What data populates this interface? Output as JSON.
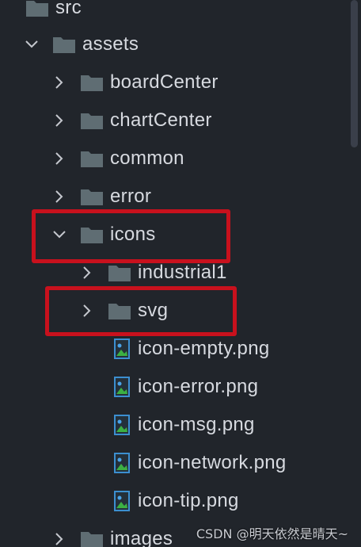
{
  "tree": {
    "rows": [
      {
        "label": "src",
        "kind": "folder",
        "expanded": true
      },
      {
        "label": "assets",
        "kind": "folder",
        "expanded": true
      },
      {
        "label": "boardCenter",
        "kind": "folder",
        "expanded": false
      },
      {
        "label": "chartCenter",
        "kind": "folder",
        "expanded": false
      },
      {
        "label": "common",
        "kind": "folder",
        "expanded": false
      },
      {
        "label": "error",
        "kind": "folder",
        "expanded": false
      },
      {
        "label": "icons",
        "kind": "folder",
        "expanded": true,
        "highlighted": true
      },
      {
        "label": "industrial1",
        "kind": "folder",
        "expanded": false
      },
      {
        "label": "svg",
        "kind": "folder",
        "expanded": false,
        "highlighted": true
      },
      {
        "label": "icon-empty.png",
        "kind": "image-file"
      },
      {
        "label": "icon-error.png",
        "kind": "image-file"
      },
      {
        "label": "icon-msg.png",
        "kind": "image-file"
      },
      {
        "label": "icon-network.png",
        "kind": "image-file"
      },
      {
        "label": "icon-tip.png",
        "kind": "image-file"
      },
      {
        "label": "images",
        "kind": "folder",
        "expanded": false
      }
    ]
  },
  "watermark": "CSDN @明天依然是晴天~",
  "colors": {
    "background": "#21252b",
    "text": "#d7dae0",
    "folder": "#5f6d73",
    "highlight": "#c8111d"
  }
}
